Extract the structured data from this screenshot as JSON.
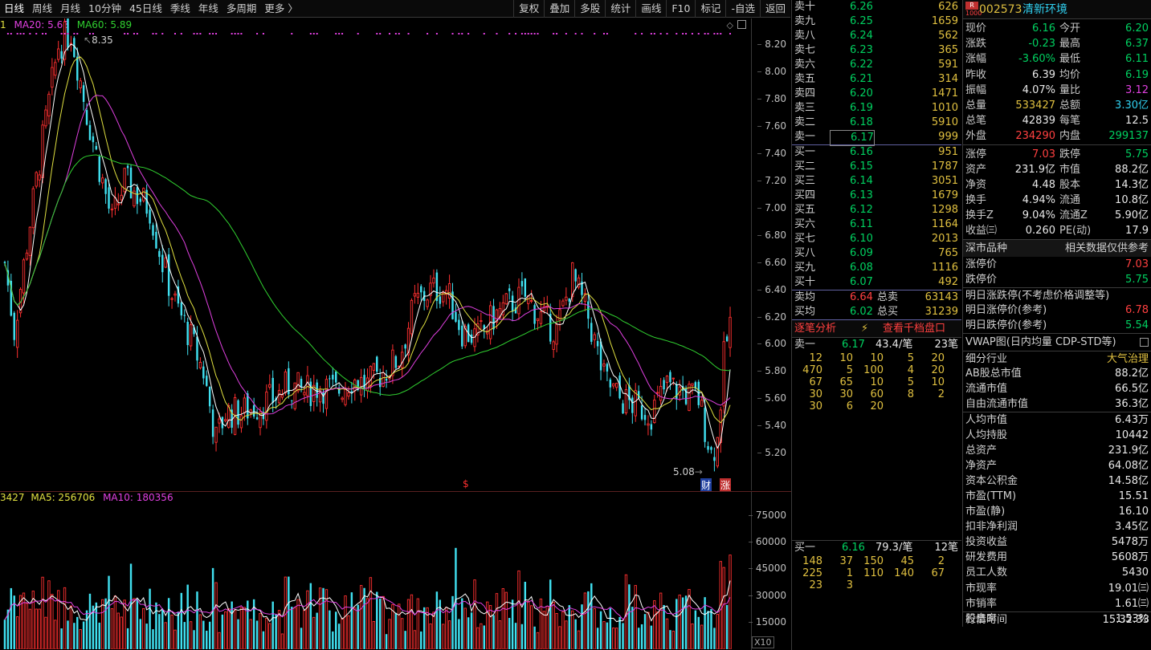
{
  "periods": [
    "日线",
    "周线",
    "月线",
    "10分钟",
    "45日线",
    "季线",
    "年线",
    "多周期",
    "更多 〉"
  ],
  "tools": [
    "复权",
    "叠加",
    "多股",
    "统计",
    "画线",
    "F10",
    "标记",
    "-自选",
    "返回"
  ],
  "kline": {
    "ma_legend_prefix": "1",
    "ma20": "MA20: 5.63",
    "ma60": "MA60: 5.89",
    "high_mark": "8.35",
    "low_mark": "5.08",
    "marker_s": "$",
    "marker_cai": "财",
    "marker_zhang": "涨",
    "yticks": [
      "8.20",
      "8.00",
      "7.80",
      "7.60",
      "7.40",
      "7.20",
      "7.00",
      "6.80",
      "6.60",
      "6.40",
      "6.20",
      "6.00",
      "5.80",
      "5.60",
      "5.40",
      "5.20"
    ]
  },
  "volume": {
    "legend_prefix": "3427",
    "ma5": "MA5: 256706",
    "ma10": "MA10: 180356",
    "yticks": [
      "75000",
      "60000",
      "45000",
      "30000",
      "15000"
    ],
    "unit": "X10"
  },
  "colors": {
    "up": "#ff3030",
    "down": "#40e0f0",
    "ma5": "#ffffff",
    "ma10": "#e0e040",
    "ma20": "#e040e0",
    "ma60": "#30d030"
  },
  "orderbook": {
    "sells": [
      {
        "label": "卖十",
        "price": "6.26",
        "vol": "626"
      },
      {
        "label": "卖九",
        "price": "6.25",
        "vol": "1659"
      },
      {
        "label": "卖八",
        "price": "6.24",
        "vol": "562"
      },
      {
        "label": "卖七",
        "price": "6.23",
        "vol": "365"
      },
      {
        "label": "卖六",
        "price": "6.22",
        "vol": "591"
      },
      {
        "label": "卖五",
        "price": "6.21",
        "vol": "314"
      },
      {
        "label": "卖四",
        "price": "6.20",
        "vol": "1471"
      },
      {
        "label": "卖三",
        "price": "6.19",
        "vol": "1010"
      },
      {
        "label": "卖二",
        "price": "6.18",
        "vol": "5910"
      },
      {
        "label": "卖一",
        "price": "6.17",
        "vol": "999"
      }
    ],
    "buys": [
      {
        "label": "买一",
        "price": "6.16",
        "vol": "951"
      },
      {
        "label": "买二",
        "price": "6.15",
        "vol": "1787"
      },
      {
        "label": "买三",
        "price": "6.14",
        "vol": "3051"
      },
      {
        "label": "买四",
        "price": "6.13",
        "vol": "1679"
      },
      {
        "label": "买五",
        "price": "6.12",
        "vol": "1298"
      },
      {
        "label": "买六",
        "price": "6.11",
        "vol": "1164"
      },
      {
        "label": "买七",
        "price": "6.10",
        "vol": "2013"
      },
      {
        "label": "买八",
        "price": "6.09",
        "vol": "765"
      },
      {
        "label": "买九",
        "price": "6.08",
        "vol": "1116"
      },
      {
        "label": "买十",
        "price": "6.07",
        "vol": "492"
      }
    ],
    "avg_sell_label": "卖均",
    "avg_sell": "6.64",
    "total_sell_label": "总卖",
    "total_sell": "63143",
    "avg_buy_label": "买均",
    "avg_buy": "6.02",
    "total_buy_label": "总买",
    "total_buy": "31239",
    "analysis": "逐笔分析",
    "thousand": "查看千档盘口",
    "sell1_head": {
      "label": "卖一",
      "price": "6.17",
      "avg": "43.4/笔",
      "count": "23笔"
    },
    "sell1_ticks": [
      [
        "12",
        "10",
        "10",
        "5",
        "20"
      ],
      [
        "470",
        "5",
        "100",
        "4",
        "20"
      ],
      [
        "67",
        "65",
        "10",
        "5",
        "10"
      ],
      [
        "30",
        "30",
        "60",
        "8",
        "2"
      ],
      [
        "30",
        "6",
        "20",
        "",
        ""
      ]
    ],
    "buy1_head": {
      "label": "买一",
      "price": "6.16",
      "avg": "79.3/笔",
      "count": "12笔"
    },
    "buy1_ticks": [
      [
        "148",
        "37",
        "150",
        "45",
        "2"
      ],
      [
        "225",
        "1",
        "110",
        "140",
        "67"
      ],
      [
        "23",
        "3",
        "",
        "",
        ""
      ]
    ]
  },
  "quote": {
    "badge_top": "R",
    "badge_bot": "1000",
    "code": "002573",
    "name": "清新环境",
    "rows": [
      {
        "a": "现价",
        "av": "6.16",
        "ac": "green",
        "b": "今开",
        "bv": "6.20",
        "bc": "green"
      },
      {
        "a": "涨跌",
        "av": "-0.23",
        "ac": "green",
        "b": "最高",
        "bv": "6.37",
        "bc": "green"
      },
      {
        "a": "涨幅",
        "av": "-3.60%",
        "ac": "green",
        "b": "最低",
        "bv": "6.11",
        "bc": "green"
      },
      {
        "a": "昨收",
        "av": "6.39",
        "ac": "white",
        "b": "均价",
        "bv": "6.19",
        "bc": "green"
      },
      {
        "a": "振幅",
        "av": "4.07%",
        "ac": "white",
        "b": "量比",
        "bv": "3.12",
        "bc": "magenta"
      },
      {
        "a": "总量",
        "av": "533427",
        "ac": "yellow",
        "b": "总额",
        "bv": "3.30亿",
        "bc": "cyan"
      },
      {
        "a": "总笔",
        "av": "42839",
        "ac": "white",
        "b": "每笔",
        "bv": "12.5",
        "bc": "white"
      },
      {
        "a": "外盘",
        "av": "234290",
        "ac": "red",
        "b": "内盘",
        "bv": "299137",
        "bc": "green"
      }
    ],
    "rows2": [
      {
        "a": "涨停",
        "av": "7.03",
        "ac": "red",
        "b": "跌停",
        "bv": "5.75",
        "bc": "green"
      },
      {
        "a": "资产",
        "av": "231.9亿",
        "ac": "white",
        "b": "市值",
        "bv": "88.2亿",
        "bc": "white"
      },
      {
        "a": "净资",
        "av": "4.48",
        "ac": "white",
        "b": "股本",
        "bv": "14.3亿",
        "bc": "white"
      },
      {
        "a": "换手",
        "av": "4.94%",
        "ac": "white",
        "b": "流通",
        "bv": "10.8亿",
        "bc": "white"
      },
      {
        "a": "换手Z",
        "av": "9.04%",
        "ac": "white",
        "b": "流通Z",
        "bv": "5.90亿",
        "bc": "white"
      },
      {
        "a": "收益㈢",
        "av": "0.260",
        "ac": "white",
        "b": "PE(动)",
        "bv": "17.9",
        "bc": "white"
      }
    ],
    "market_label": "深市品种",
    "market_note": "相关数据仅供参考",
    "limit_up_label": "涨停价",
    "limit_up": "7.03",
    "limit_down_label": "跌停价",
    "limit_down": "5.75",
    "tomorrow": "明日涨跌停(不考虑价格调整等)",
    "tomorrow_up_label": "明日涨停价(参考)",
    "tomorrow_up": "6.78",
    "tomorrow_down_label": "明日跌停价(参考)",
    "tomorrow_down": "5.54",
    "vwap": "VWAP图(日内均量 CDP-STD等)",
    "industry_label": "细分行业",
    "industry": "大气治理",
    "fund": [
      {
        "a": "AB股总市值",
        "v": "88.2亿"
      },
      {
        "a": "流通市值",
        "v": "66.5亿"
      },
      {
        "a": "自由流通市值",
        "v": "36.3亿"
      },
      {
        "a": "人均市值",
        "v": "6.43万"
      },
      {
        "a": "人均持股",
        "v": "10442"
      },
      {
        "a": "总资产",
        "v": "231.9亿"
      },
      {
        "a": "净资产",
        "v": "64.08亿"
      },
      {
        "a": "资本公积金",
        "v": "14.58亿"
      },
      {
        "a": "市盈(TTM)",
        "v": "15.51"
      },
      {
        "a": "市盈(静)",
        "v": "16.10"
      },
      {
        "a": "扣非净利润",
        "v": "3.45亿"
      },
      {
        "a": "投资收益",
        "v": "5478万"
      },
      {
        "a": "研发费用",
        "v": "5608万"
      },
      {
        "a": "员工人数",
        "v": "5430"
      },
      {
        "a": "市现率",
        "v": "19.01㈢"
      },
      {
        "a": "市销率",
        "v": "1.61㈢"
      },
      {
        "a": "股息率",
        "v": "1.53%"
      }
    ],
    "time_label": "行情时间",
    "time": "15:32:33"
  },
  "chart_data": {
    "type": "candlestick",
    "ylim": [
      5.0,
      8.35
    ],
    "anchors": [
      [
        0,
        6.6
      ],
      [
        3,
        6.1
      ],
      [
        8,
        6.9
      ],
      [
        12,
        7.5
      ],
      [
        17,
        8.2
      ],
      [
        21,
        8.3
      ],
      [
        26,
        7.7
      ],
      [
        30,
        7.3
      ],
      [
        34,
        6.9
      ],
      [
        38,
        7.2
      ],
      [
        42,
        7.1
      ],
      [
        46,
        7.0
      ],
      [
        50,
        6.6
      ],
      [
        54,
        6.3
      ],
      [
        58,
        6.1
      ],
      [
        63,
        5.8
      ],
      [
        67,
        5.3
      ],
      [
        70,
        5.5
      ],
      [
        75,
        5.5
      ],
      [
        80,
        5.55
      ],
      [
        85,
        5.6
      ],
      [
        90,
        5.7
      ],
      [
        95,
        5.65
      ],
      [
        100,
        5.7
      ],
      [
        105,
        5.65
      ],
      [
        110,
        5.75
      ],
      [
        115,
        5.7
      ],
      [
        120,
        5.8
      ],
      [
        125,
        5.9
      ],
      [
        130,
        6.3
      ],
      [
        135,
        6.4
      ],
      [
        140,
        6.4
      ],
      [
        145,
        6.1
      ],
      [
        150,
        6.05
      ],
      [
        155,
        6.2
      ],
      [
        160,
        6.3
      ],
      [
        165,
        6.35
      ],
      [
        170,
        6.2
      ],
      [
        175,
        6.1
      ],
      [
        180,
        6.5
      ],
      [
        185,
        6.2
      ],
      [
        190,
        5.75
      ],
      [
        195,
        5.6
      ],
      [
        200,
        5.55
      ],
      [
        205,
        5.5
      ],
      [
        210,
        5.7
      ],
      [
        215,
        5.65
      ],
      [
        220,
        5.6
      ],
      [
        224,
        5.2
      ],
      [
        226,
        5.3
      ],
      [
        228,
        5.9
      ],
      [
        230,
        6.16
      ]
    ],
    "n": 231
  }
}
